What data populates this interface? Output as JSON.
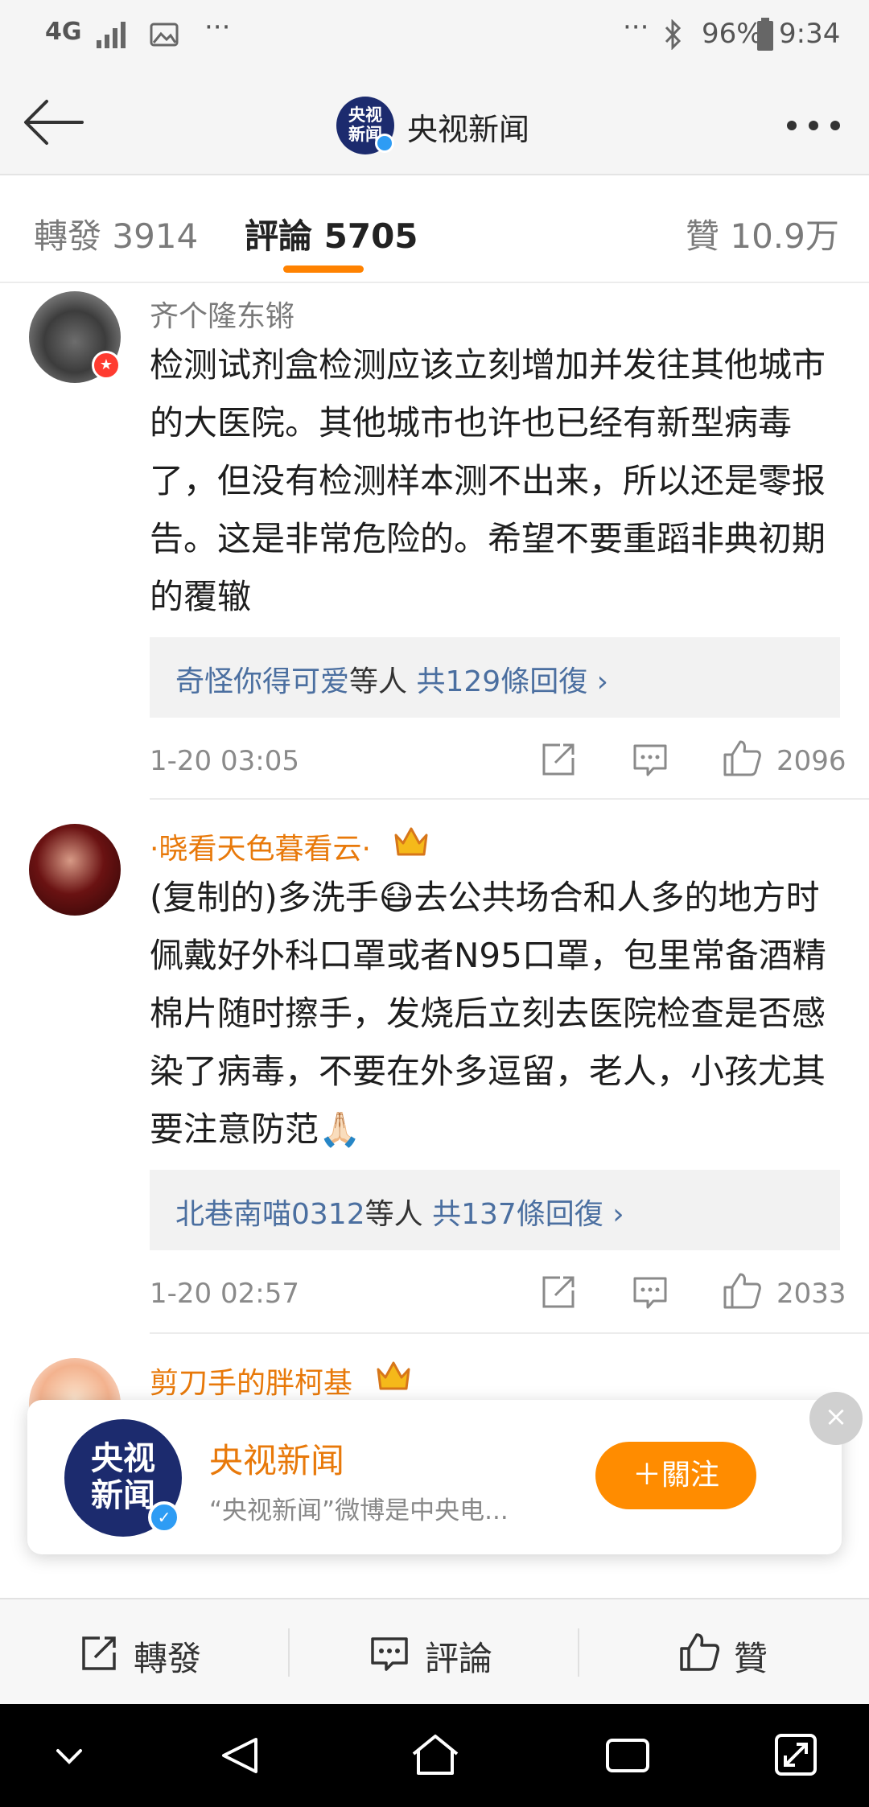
{
  "status_bar": {
    "network": "4G",
    "more_left": "···",
    "more_right": "···",
    "battery": "96%",
    "time": "9:34"
  },
  "nav": {
    "title": "央视新闻",
    "logo_line1": "央视",
    "logo_line2": "新闻"
  },
  "tabs": [
    {
      "label": "轉發 3914",
      "active": false
    },
    {
      "label": "評論 5705",
      "active": true
    },
    {
      "label": "贊 10.9万",
      "active": false
    }
  ],
  "comments": [
    {
      "username": "齐个隆东锵",
      "body": "检测试剂盒检测应该立刻增加并发往其他城市的大医院。其他城市也许也已经有新型病毒了，但没有检测样本测不出来，所以还是零报告。这是非常危险的。希望不要重蹈非典初期的覆辙",
      "reply_users": "奇怪你得可爱",
      "reply_mid": "等人",
      "reply_total": "共129條回復",
      "time": "1-20 03:05",
      "likes": "2096"
    },
    {
      "username": "·晓看天色暮看云·",
      "body": "(复制的)多洗手😷去公共场合和人多的地方时佩戴好外科口罩或者N95口罩，包里常备酒精棉片随时擦手，发烧后立刻去医院检查是否感染了病毒，不要在外多逗留，老人，小孩尤其要注意防范🙏🏻",
      "reply_users": "北巷南喵0312",
      "reply_mid": "等人",
      "reply_total": "共137條回復",
      "time": "1-20 02:57",
      "likes": "2033"
    },
    {
      "username": "剪刀手的胖柯基"
    }
  ],
  "popup": {
    "name": "央视新闻",
    "description": "“央视新闻”微博是中央电...",
    "follow": "＋關注",
    "close": "×"
  },
  "actions": {
    "repost": "轉發",
    "comment": "評論",
    "like": "贊"
  },
  "colors": {
    "accent": "#ff8200",
    "link": "#4b6fa0",
    "vip_name": "#e8790a"
  }
}
